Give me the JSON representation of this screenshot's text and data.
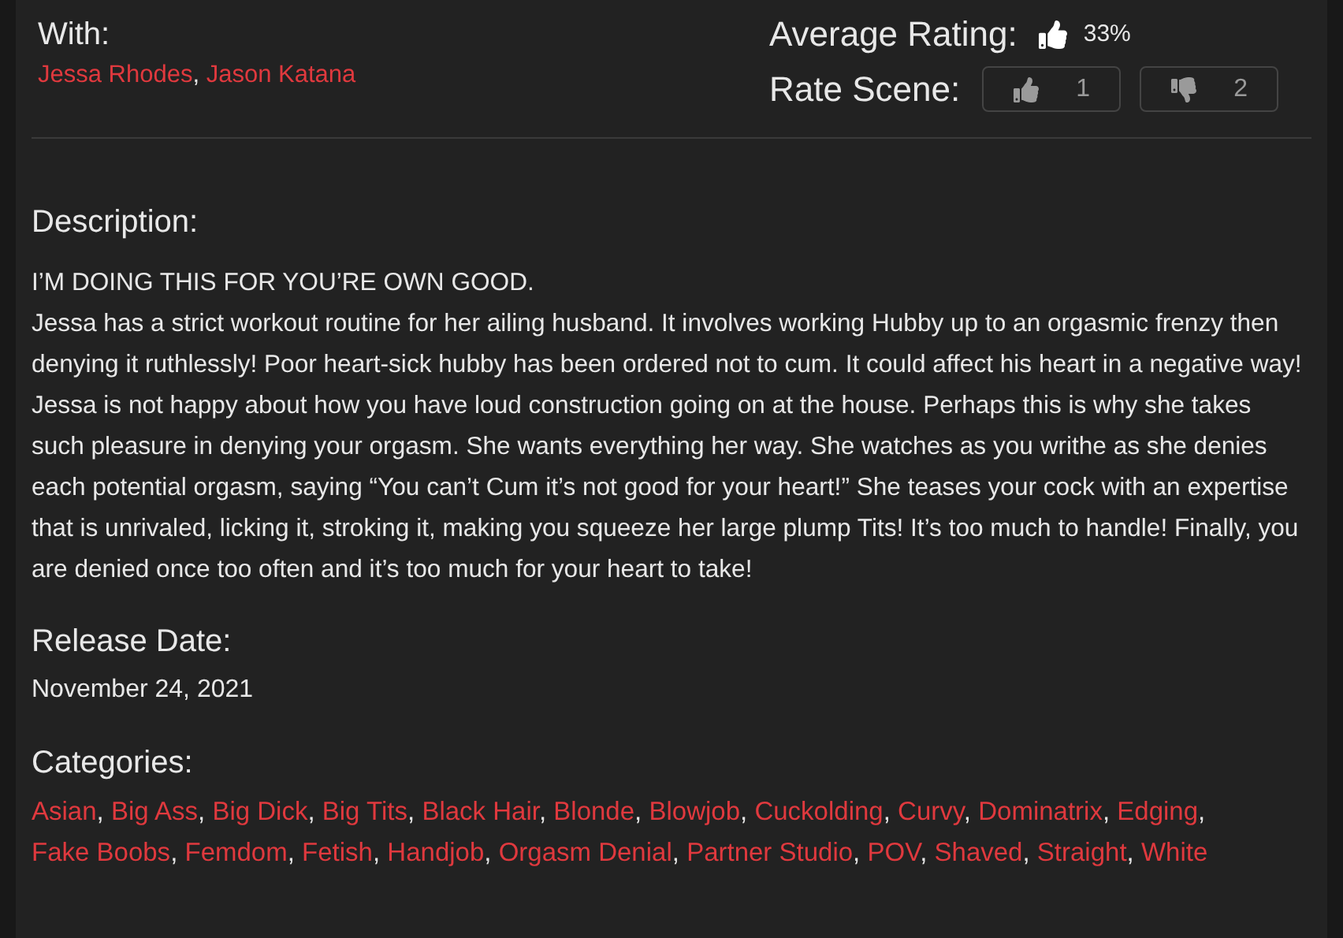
{
  "with": {
    "label": "With:",
    "separator": ",",
    "performers": [
      "Jessa Rhodes",
      "Jason Katana"
    ]
  },
  "rating": {
    "label": "Average Rating:",
    "value": "33%"
  },
  "rate_scene": {
    "label": "Rate Scene:",
    "buttons": [
      {
        "kind": "up",
        "count": "1"
      },
      {
        "kind": "down",
        "count": "2"
      }
    ]
  },
  "description": {
    "heading": "Description:",
    "paragraphs": [
      "I’M DOING THIS FOR YOU’RE OWN GOOD.",
      "Jessa has a strict workout routine for her ailing husband. It involves working Hubby up to an orgasmic frenzy then denying it ruthlessly! Poor heart-sick hubby has been ordered not to cum. It could affect his heart in a negative way! Jessa is not happy about how you have loud construction going on at the house. Perhaps this is why she takes such pleasure in denying your orgasm. She wants everything her way. She watches as you writhe as she denies each potential orgasm, saying “You can’t Cum it’s not good for your heart!” She teases your cock with an expertise that is unrivaled, licking it, stroking it, making you squeeze her large plump Tits! It’s too much to handle! Finally, you are denied once too often and it’s too much for your heart to take!"
    ]
  },
  "release_date": {
    "heading": "Release Date:",
    "value": "November 24, 2021"
  },
  "categories": {
    "heading": "Categories:",
    "separator": ",",
    "items": [
      "Asian",
      "Big Ass",
      "Big Dick",
      "Big Tits",
      "Black Hair",
      "Blonde",
      "Blowjob",
      "Cuckolding",
      "Curvy",
      "Dominatrix",
      "Edging",
      "Fake Boobs",
      "Femdom",
      "Fetish",
      "Handjob",
      "Orgasm Denial",
      "Partner Studio",
      "POV",
      "Shaved",
      "Straight",
      "White"
    ]
  }
}
